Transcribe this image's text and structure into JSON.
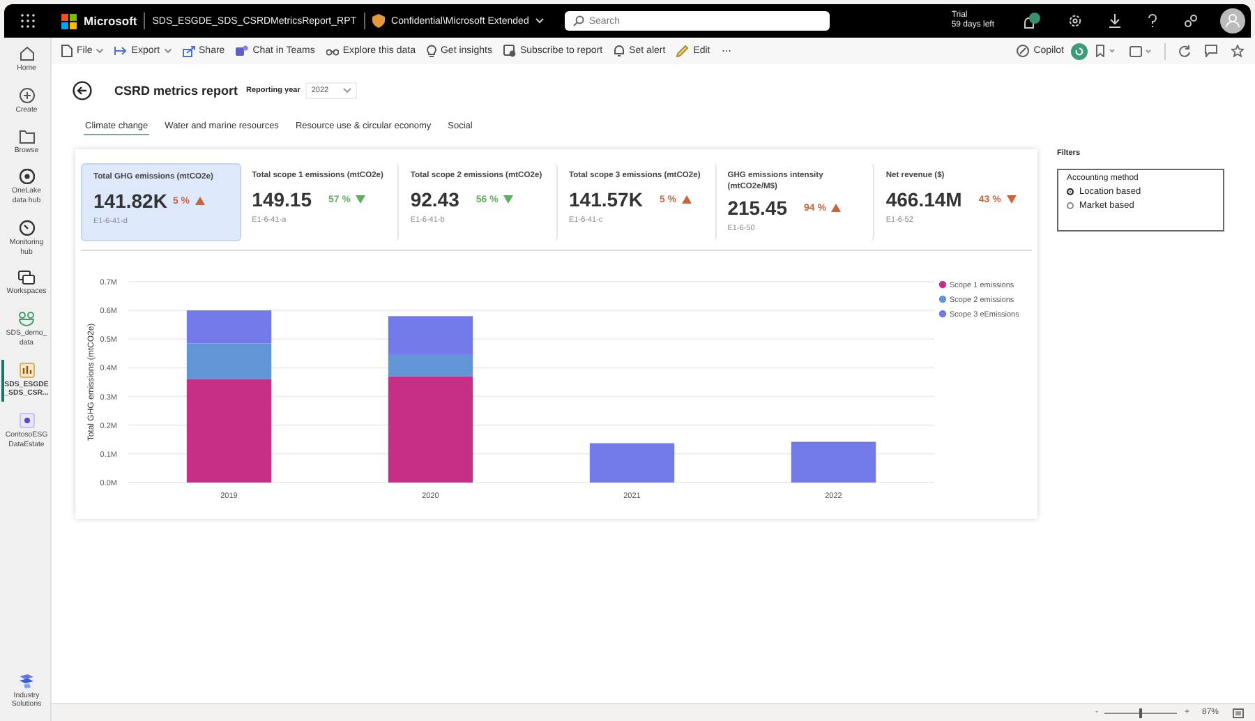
{
  "top_bar": {
    "brand": "Microsoft",
    "report_name": "SDS_ESGDE_SDS_CSRDMetricsReport_RPT",
    "sensitivity": "Confidential\\Microsoft Extended",
    "search": {
      "placeholder": "Search"
    },
    "trial": [
      "Trial",
      "59 days left"
    ]
  },
  "sidebar": {
    "items": [
      {
        "label": "Home",
        "selected": false
      },
      {
        "label": "Create",
        "selected": false
      },
      {
        "label": "Browse",
        "selected": false
      },
      {
        "label": "OneLake data hub",
        "selected": false
      },
      {
        "label": "Monitoring hub",
        "selected": false
      },
      {
        "label": "Workspaces",
        "selected": false
      },
      {
        "label": "SDS_demo_data",
        "selected": false
      },
      {
        "label": "SDS_ESGDE _SDS_CSR...",
        "selected": true
      },
      {
        "label": "ContosoESG DataEstate",
        "selected": false
      }
    ],
    "bottom_item": {
      "label": "Industry Solutions"
    }
  },
  "toolbar": {
    "left": [
      {
        "label": "File",
        "dropdown": true
      },
      {
        "label": "Export",
        "dropdown": true
      },
      {
        "label": "Share",
        "dropdown": false
      },
      {
        "label": "Chat in Teams",
        "dropdown": false
      },
      {
        "label": "Explore this data",
        "dropdown": false
      },
      {
        "label": "Get insights",
        "dropdown": false
      },
      {
        "label": "Subscribe to report",
        "dropdown": false
      },
      {
        "label": "Set alert",
        "dropdown": false
      },
      {
        "label": "Edit",
        "dropdown": false
      },
      {
        "label": "⋯",
        "dropdown": false
      }
    ],
    "copilot": "Copilot"
  },
  "report": {
    "title": "CSRD metrics report",
    "year_label": "Reporting year",
    "year_value": "2022",
    "tabs": [
      {
        "label": "Climate change",
        "selected": true
      },
      {
        "label": "Water and marine resources",
        "selected": false
      },
      {
        "label": "Resource use & circular economy",
        "selected": false
      },
      {
        "label": "Social",
        "selected": false
      }
    ],
    "kpis": [
      {
        "title": "Total GHG emissions (mtCO2e)",
        "value": "141.82K",
        "change": "5 %",
        "kind": "up",
        "color": "#c9643c",
        "code": "E1-6-41-d",
        "selected": true
      },
      {
        "title": "Total scope 1 emissions (mtCO2e)",
        "value": "149.15",
        "change": "57 %",
        "kind": "down",
        "color": "#5fae5f",
        "code": "E1-6-41-a",
        "selected": false
      },
      {
        "title": "Total scope 2 emissions (mtCO2e)",
        "value": "92.43",
        "change": "56 %",
        "kind": "down",
        "color": "#5fae5f",
        "code": "E1-6-41-b",
        "selected": false
      },
      {
        "title": "Total scope 3 emissions (mtCO2e)",
        "value": "141.57K",
        "change": "5 %",
        "kind": "up",
        "color": "#c9643c",
        "code": "E1-6-41-c",
        "selected": false
      },
      {
        "title": "GHG emissions intensity (mtCO2e/M$)",
        "value": "215.45",
        "change": "94 %",
        "kind": "up",
        "color": "#c9643c",
        "code": "E1-6-50",
        "selected": false
      },
      {
        "title": "Net revenue ($)",
        "value": "466.14M",
        "change": "43 %",
        "kind": "down",
        "color": "#c9643c",
        "code": "E1-6-52",
        "selected": false
      }
    ],
    "chart_data": {
      "type": "bar",
      "stacked": true,
      "grid": true,
      "legend": "right",
      "ylabel": "Total GHG emissions (mtCO2e)",
      "categories": [
        "2019",
        "2020",
        "2021",
        "2022"
      ],
      "series": [
        {
          "name": "Scope 1 emissions",
          "color": "#c72f86",
          "values": [
            0.36,
            0.37,
            null,
            null
          ]
        },
        {
          "name": "Scope 2 emissions",
          "color": "#6096d6",
          "values": [
            0.125,
            0.075,
            null,
            null
          ]
        },
        {
          "name": "Scope 3 eEmissions",
          "color": "#717ae8",
          "values": [
            0.115,
            0.135,
            0.137,
            0.142
          ]
        }
      ],
      "ylim": [
        0,
        0.7
      ],
      "yticks": [
        {
          "value": 0,
          "label": "0.0M"
        },
        {
          "value": 0.1,
          "label": "0.1M"
        },
        {
          "value": 0.2,
          "label": "0.2M"
        },
        {
          "value": 0.3,
          "label": "0.3M"
        },
        {
          "value": 0.4,
          "label": "0.4M"
        },
        {
          "value": 0.5,
          "label": "0.5M"
        },
        {
          "value": 0.6,
          "label": "0.6M"
        },
        {
          "value": 0.7,
          "label": "0.7M"
        }
      ]
    }
  },
  "filters": {
    "title": "Filters",
    "group": "Accounting method",
    "options": [
      {
        "label": "Location based",
        "selected": true
      },
      {
        "label": "Market based",
        "selected": false
      }
    ]
  },
  "status_bar": {
    "zoom_out": "-",
    "zoom_in": "+",
    "zoom": {
      "level": 0.5
    },
    "zoom_text": "87%"
  }
}
